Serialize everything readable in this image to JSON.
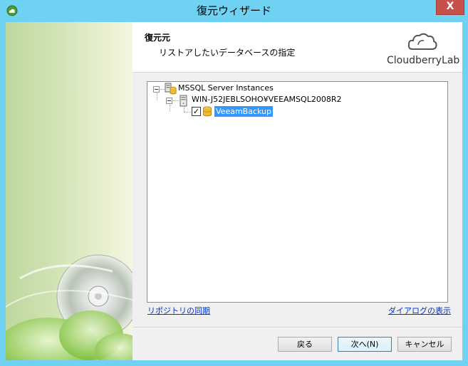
{
  "window": {
    "title": "復元ウィザード",
    "close_glyph": "X"
  },
  "header": {
    "title": "復元元",
    "subtitle": "リストアしたいデータベースの指定",
    "logo_text": "CloudberryLab"
  },
  "tree": {
    "root": {
      "label": "MSSQL Server Instances"
    },
    "server": {
      "label": "WIN-J52JEBLSOHO¥VEEAMSQL2008R2"
    },
    "database": {
      "label": "VeeamBackup",
      "checked": true,
      "check_glyph": "✓"
    }
  },
  "links": {
    "sync": "リポジトリの同期",
    "show_dialog": "ダイアログの表示"
  },
  "buttons": {
    "back": "戻る",
    "next": "次へ(N)",
    "cancel": "キャンセル"
  },
  "icons": {
    "app": "cloud-icon",
    "server_group": "server-group-icon",
    "server": "server-icon",
    "database": "database-icon",
    "logo": "cloud-logo-icon",
    "sidebar_art": "disc-icon"
  }
}
